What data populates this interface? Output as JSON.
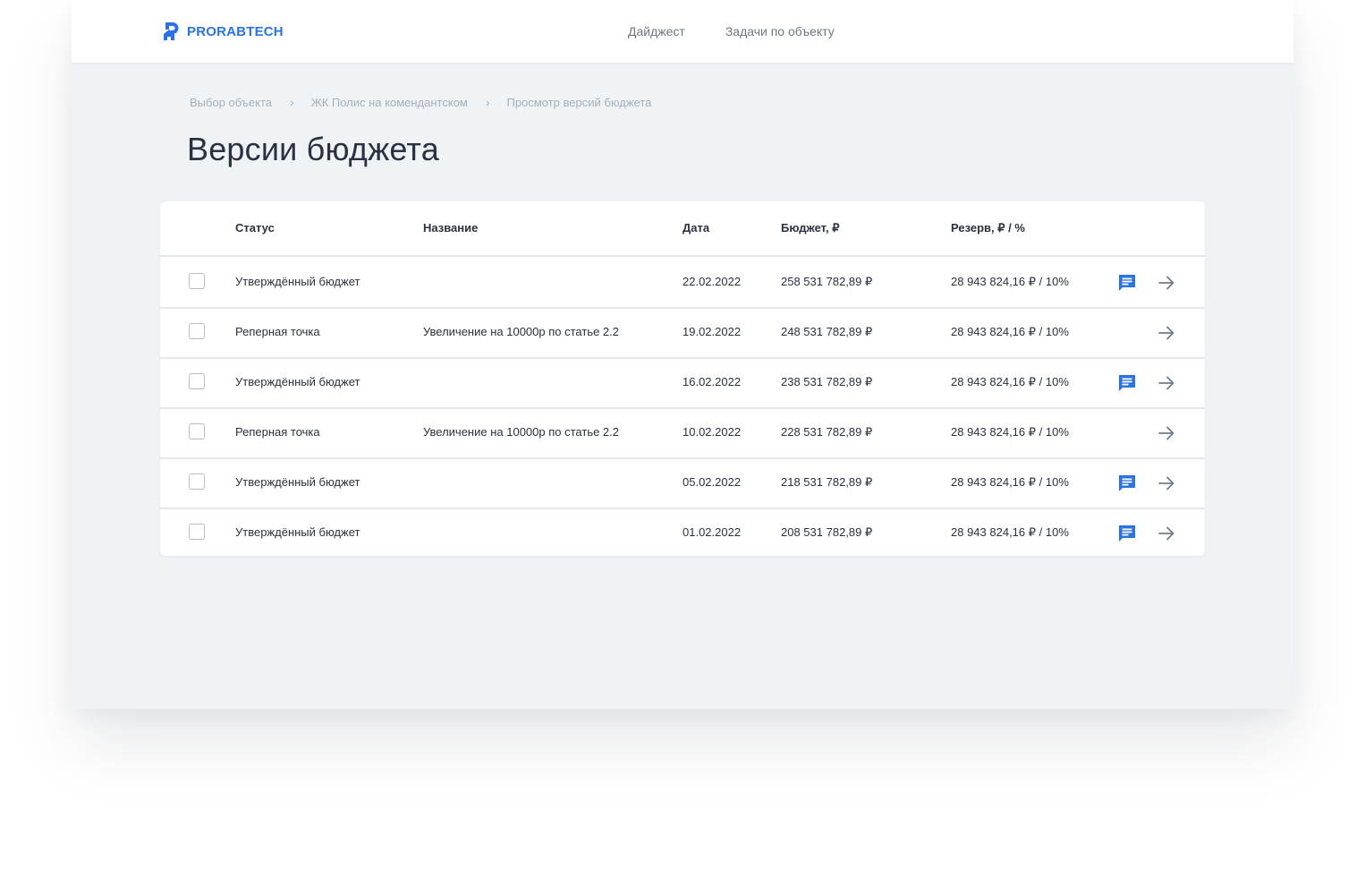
{
  "brand": {
    "name": "PRORABTECH",
    "color": "#2a73e6"
  },
  "nav": {
    "items": [
      "Дайджест",
      "Задачи по объекту"
    ]
  },
  "breadcrumb": {
    "items": [
      "Выбор объекта",
      "ЖК Полис на комендантском",
      "Просмотр версий бюджета"
    ],
    "separator": "›"
  },
  "page": {
    "title": "Версии бюджета"
  },
  "table": {
    "columns": {
      "status": "Статус",
      "name": "Название",
      "date": "Дата",
      "budget": "Бюджет, ₽",
      "reserve": "Резерв, ₽ / %"
    },
    "rows": [
      {
        "status": "Утверждённый бюджет",
        "name": "",
        "date": "22.02.2022",
        "budget": "258 531 782,89 ₽",
        "reserve": "28 943 824,16 ₽ / 10%",
        "has_comment": true
      },
      {
        "status": "Реперная точка",
        "name": "Увеличение на 10000р по статье 2.2",
        "date": "19.02.2022",
        "budget": "248 531 782,89 ₽",
        "reserve": "28 943 824,16 ₽ / 10%",
        "has_comment": false
      },
      {
        "status": "Утверждённый бюджет",
        "name": "",
        "date": "16.02.2022",
        "budget": "238 531 782,89 ₽",
        "reserve": "28 943 824,16 ₽ / 10%",
        "has_comment": true
      },
      {
        "status": "Реперная точка",
        "name": "Увеличение на 10000р по статье 2.2",
        "date": "10.02.2022",
        "budget": "228 531 782,89 ₽",
        "reserve": "28 943 824,16 ₽ / 10%",
        "has_comment": false
      },
      {
        "status": "Утверждённый бюджет",
        "name": "",
        "date": "05.02.2022",
        "budget": "218 531 782,89 ₽",
        "reserve": "28 943 824,16 ₽ / 10%",
        "has_comment": true
      },
      {
        "status": "Утверждённый бюджет",
        "name": "",
        "date": "01.02.2022",
        "budget": "208 531 782,89 ₽",
        "reserve": "28 943 824,16 ₽ / 10%",
        "has_comment": true
      }
    ]
  },
  "icons": {
    "comment": "comment-icon",
    "arrow": "arrow-right-icon",
    "comment_color": "#2a73e6",
    "arrow_color": "#6f7d8c"
  }
}
